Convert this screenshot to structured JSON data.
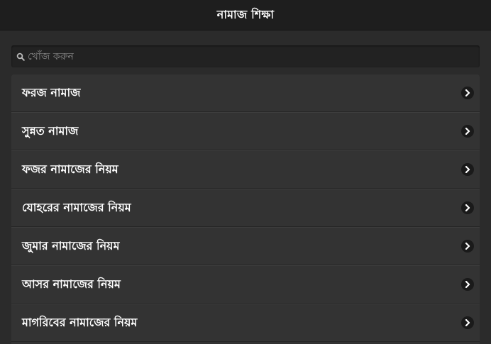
{
  "header": {
    "title": "নামাজ শিক্ষা"
  },
  "search": {
    "placeholder": "খোঁজ করুন",
    "icon": "search-icon"
  },
  "list": {
    "items": [
      {
        "label": "ফরজ নামাজ",
        "icon": "chevron-right-icon"
      },
      {
        "label": "সুন্নত নামাজ",
        "icon": "chevron-right-icon"
      },
      {
        "label": "ফজর নামাজের নিয়ম",
        "icon": "chevron-right-icon"
      },
      {
        "label": "যোহরের নামাজের নিয়ম",
        "icon": "chevron-right-icon"
      },
      {
        "label": "জুমার নামাজের নিয়ম",
        "icon": "chevron-right-icon"
      },
      {
        "label": "আসর নামাজের নিয়ম",
        "icon": "chevron-right-icon"
      },
      {
        "label": "মাগরিবের নামাজের নিয়ম",
        "icon": "chevron-right-icon"
      }
    ]
  },
  "colors": {
    "header_bg": "#1e1e1e",
    "page_bg": "#2b2b2b",
    "item_bg": "#333333",
    "text": "#ffffff"
  }
}
